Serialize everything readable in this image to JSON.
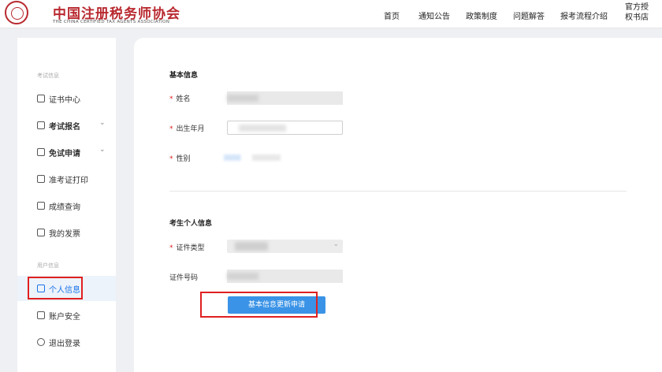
{
  "header": {
    "logo_title": "中国注册税务师协会",
    "logo_subtitle": "THE CHINA CERTIFIED TAX AGENTS ASSOCIATION",
    "nav": [
      "首页",
      "通知公告",
      "政策制度",
      "问题解答",
      "报考流程介绍",
      "官方授权书店"
    ]
  },
  "sidebar": {
    "group_exam": "考试信息",
    "group_user": "用户信息",
    "items": [
      {
        "label": "证书中心",
        "icon": "certificate-icon"
      },
      {
        "label": "考试报名",
        "icon": "registration-icon",
        "expandable": true
      },
      {
        "label": "免试申请",
        "icon": "edit-icon",
        "expandable": true
      },
      {
        "label": "准考证打印",
        "icon": "printer-icon"
      },
      {
        "label": "成绩查询",
        "icon": "score-icon"
      },
      {
        "label": "我的发票",
        "icon": "invoice-icon"
      },
      {
        "label": "个人信息",
        "icon": "id-card-icon",
        "active": true
      },
      {
        "label": "账户安全",
        "icon": "shield-icon"
      },
      {
        "label": "退出登录",
        "icon": "power-icon"
      }
    ],
    "expand_glyph": "⌄"
  },
  "form": {
    "basic_title": "基本信息",
    "name_label": "姓名",
    "birth_label": "出生年月",
    "gender_label": "性别",
    "personal_title": "考生个人信息",
    "id_type_label": "证件类型",
    "id_number_label": "证件号码",
    "required_mark": "*",
    "select_arrow": "⌄",
    "submit_label": "基本信息更新申请"
  },
  "colors": {
    "brand": "#b8292f",
    "primary": "#3a93e6",
    "highlight": "#e02020"
  }
}
